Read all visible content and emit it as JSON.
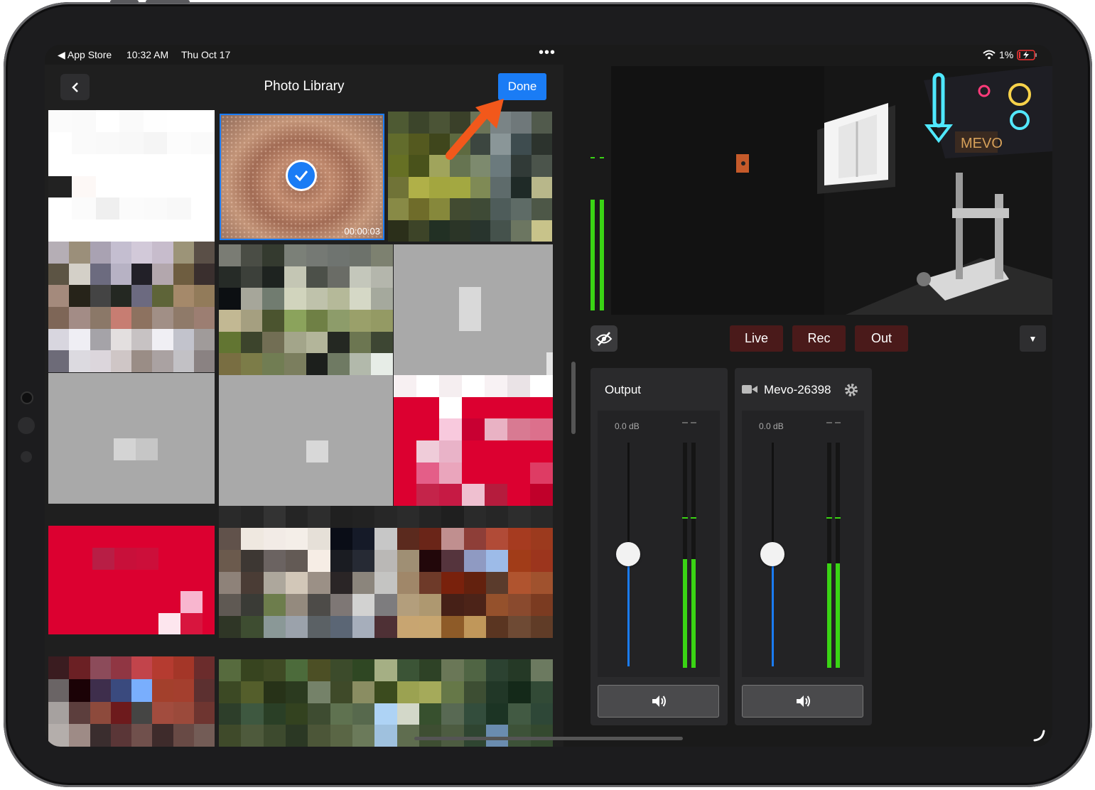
{
  "status_bar": {
    "back_app": "App Store",
    "time": "10:32 AM",
    "date": "Thu Oct 17",
    "battery": "1%"
  },
  "photo_library": {
    "title": "Photo Library",
    "done_label": "Done",
    "selected_video_duration": "00:00:03"
  },
  "controls": {
    "live": "Live",
    "rec": "Rec",
    "out": "Out"
  },
  "mixers": [
    {
      "name": "Output",
      "db": "0.0 dB",
      "fader_level": 0.5,
      "meter_level": 0.49
    },
    {
      "name": "Mevo-26398",
      "db": "0.0 dB",
      "fader_level": 0.5,
      "meter_level": 0.46
    }
  ],
  "colors": {
    "accent": "#1a7cf5",
    "meter": "#3ad414",
    "annotation_arrow": "#f2581b"
  }
}
